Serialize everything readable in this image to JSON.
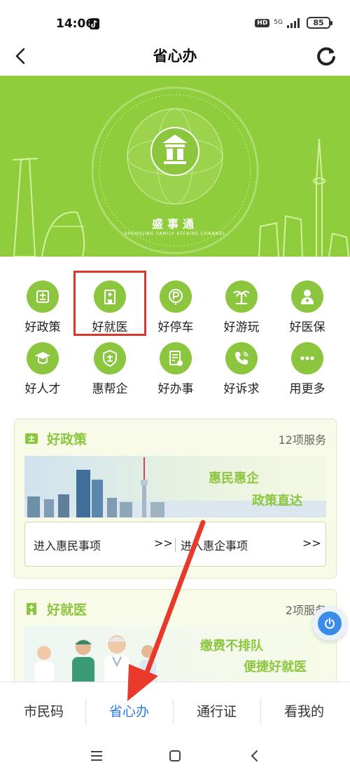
{
  "status_bar": {
    "time": "14:06",
    "hd": "HD",
    "network": "5G",
    "battery": "85"
  },
  "header": {
    "title": "省心办"
  },
  "hero": {
    "logo_text": "盛事通",
    "logo_sub": "SHENGJING FAMILY AFFAIRS CHANNEL"
  },
  "services": [
    {
      "label": "好政策",
      "icon": "policy-icon"
    },
    {
      "label": "好就医",
      "icon": "hospital-icon"
    },
    {
      "label": "好停车",
      "icon": "parking-icon"
    },
    {
      "label": "好游玩",
      "icon": "palm-tree-icon"
    },
    {
      "label": "好医保",
      "icon": "doctor-icon"
    },
    {
      "label": "好人才",
      "icon": "graduate-icon"
    },
    {
      "label": "惠帮企",
      "icon": "enterprise-shield-icon"
    },
    {
      "label": "好办事",
      "icon": "document-icon"
    },
    {
      "label": "好诉求",
      "icon": "phone-icon"
    },
    {
      "label": "用更多",
      "icon": "more-icon"
    }
  ],
  "policy_card": {
    "title": "好政策",
    "count": "12项服务",
    "banner_line1": "惠民惠企",
    "banner_line2": "政策直达",
    "link_left": "进入惠民事项",
    "link_right": "进入惠企事项",
    "arrow": ">>"
  },
  "medical_card": {
    "title": "好就医",
    "count": "2项服务",
    "banner_line1": "缴费不排队",
    "banner_line2": "便捷好就医"
  },
  "bottom_nav": [
    {
      "label": "市民码",
      "active": false
    },
    {
      "label": "省心办",
      "active": true
    },
    {
      "label": "通行证",
      "active": false
    },
    {
      "label": "看我的",
      "active": false
    }
  ],
  "colors": {
    "brand_green": "#8cc63f",
    "active_blue": "#2a7be0",
    "highlight_red": "#d9372b",
    "arrow_red": "#e8392b"
  }
}
